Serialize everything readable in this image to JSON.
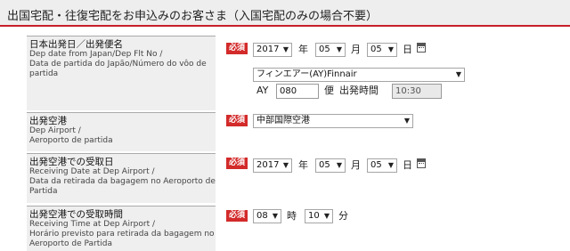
{
  "header": {
    "title": "出国宅配・往復宅配をお申込みのお客さま（入国宅配のみの場合不要）"
  },
  "required_badge": "必須",
  "rows": {
    "departure_flight": {
      "label_jp": "日本出発日／出発便名",
      "label_en": "Dep date from Japan/Dep Flt No /",
      "label_pt": "Data de partida do Japão/Número do vôo de partida",
      "year": "2017",
      "year_unit": "年",
      "month": "05",
      "month_unit": "月",
      "day": "05",
      "day_unit": "日",
      "airline": "フィンエアー(AY)Finnair",
      "flight_prefix": "AY",
      "flight_number": "080",
      "flight_unit": "便",
      "dep_time_label": "出発時間",
      "dep_time": "10:30"
    },
    "departure_airport": {
      "label_jp": "出発空港",
      "label_en": "Dep Airport /",
      "label_pt": "Aeroporto de partida",
      "airport": "中部国際空港"
    },
    "receiving_date": {
      "label_jp": "出発空港での受取日",
      "label_en": "Receiving Date at Dep Airport /",
      "label_pt": "Data da retirada da bagagem no Aeroporto de Partida",
      "year": "2017",
      "year_unit": "年",
      "month": "05",
      "month_unit": "月",
      "day": "05",
      "day_unit": "日"
    },
    "receiving_time": {
      "label_jp": "出発空港での受取時間",
      "label_en": "Receiving Time at Dep Airport /",
      "label_pt": "Horário previsto para retirada da bagagem no Aeroporto de Partida",
      "hour": "08",
      "hour_unit": "時",
      "minute": "10",
      "minute_unit": "分"
    }
  },
  "icons": {
    "dropdown": "▼",
    "calendar": "calendar-icon"
  }
}
